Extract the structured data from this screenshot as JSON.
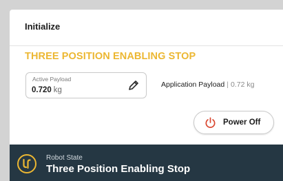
{
  "header": {
    "title": "Initialize"
  },
  "warning": {
    "text": "THREE POSITION ENABLING STOP",
    "color": "#ecb732"
  },
  "active_payload": {
    "label": "Active Payload",
    "value": "0.720",
    "unit": "kg",
    "edit_icon": "pencil-icon"
  },
  "application_payload": {
    "label": "Application Payload",
    "separator": "|",
    "value": "0.72 kg"
  },
  "power_button": {
    "label": "Power Off",
    "icon": "power-icon",
    "icon_color": "#d9462f"
  },
  "robot_state": {
    "caption": "Robot State",
    "value": "Three Position Enabling Stop",
    "logo": "universal-robots-logo",
    "logo_color": "#ecb732",
    "bar_color": "#253743"
  }
}
